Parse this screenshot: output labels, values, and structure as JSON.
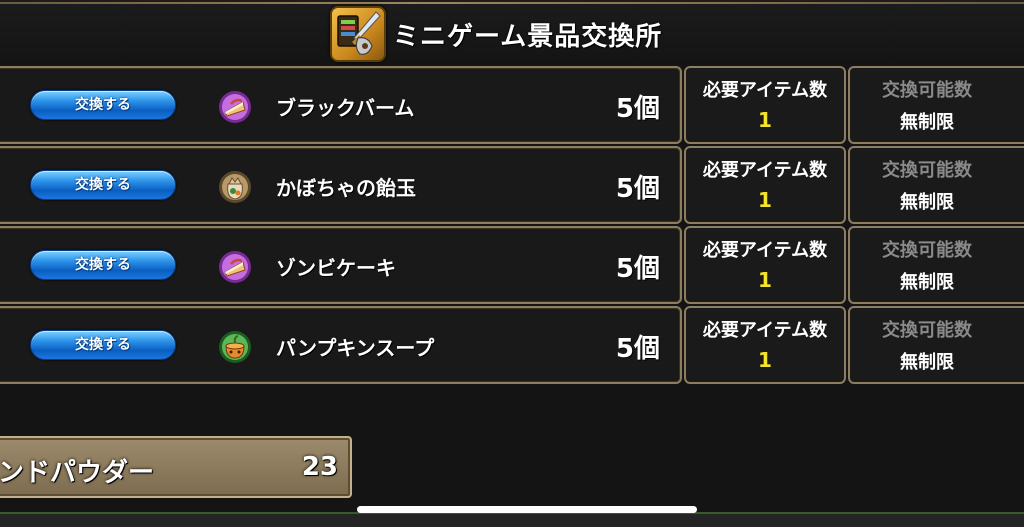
{
  "header": {
    "title": "ミニゲーム景品交換所",
    "icon": "sword-shield-icon"
  },
  "labels": {
    "exchange_button": "交換する",
    "required_items": "必要アイテム数",
    "exchangeable_count": "交換可能数"
  },
  "rows": [
    {
      "item_name": "ブラックバーム",
      "icon": "cake-slice-icon",
      "icon_color": "#b83fd6",
      "count": "5個",
      "required": "1",
      "limit": "無制限"
    },
    {
      "item_name": "かぼちゃの飴玉",
      "icon": "candy-bag-icon",
      "icon_color": "#9a7a4a",
      "count": "5個",
      "required": "1",
      "limit": "無制限"
    },
    {
      "item_name": "ゾンビケーキ",
      "icon": "cake-slice-icon",
      "icon_color": "#b83fd6",
      "count": "5個",
      "required": "1",
      "limit": "無制限"
    },
    {
      "item_name": "パンプキンスープ",
      "icon": "soup-pot-icon",
      "icon_color": "#3a9a3a",
      "count": "5個",
      "required": "1",
      "limit": "無制限"
    }
  ],
  "currency": {
    "label": "ンドパウダー",
    "value": "23"
  }
}
